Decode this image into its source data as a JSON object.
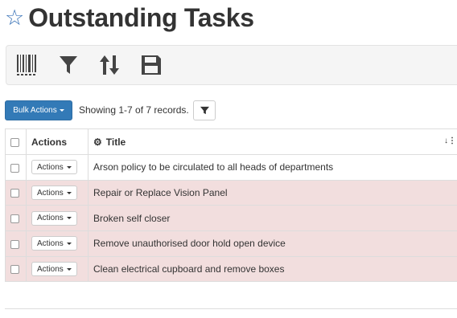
{
  "page": {
    "title": "Outstanding Tasks"
  },
  "toolbar": {
    "icons": [
      "barcode-icon",
      "filter-icon",
      "sort-icon",
      "save-icon"
    ]
  },
  "controls": {
    "bulk_actions_label": "Bulk Actions",
    "showing_text": "Showing 1-7 of 7 records."
  },
  "table": {
    "columns": {
      "actions": "Actions",
      "title": "Title"
    },
    "action_label": "Actions",
    "rows": [
      {
        "title": "Arson policy to be circulated to all heads of departments",
        "status": "normal"
      },
      {
        "title": "Repair or Replace Vision Panel",
        "status": "overdue"
      },
      {
        "title": "Broken self closer",
        "status": "overdue"
      },
      {
        "title": "Remove unauthorised door hold open device",
        "status": "overdue"
      },
      {
        "title": "Clean electrical cupboard and remove boxes",
        "status": "overdue"
      }
    ]
  },
  "colors": {
    "primary": "#337ab7",
    "overdue_row": "#f2dede"
  }
}
